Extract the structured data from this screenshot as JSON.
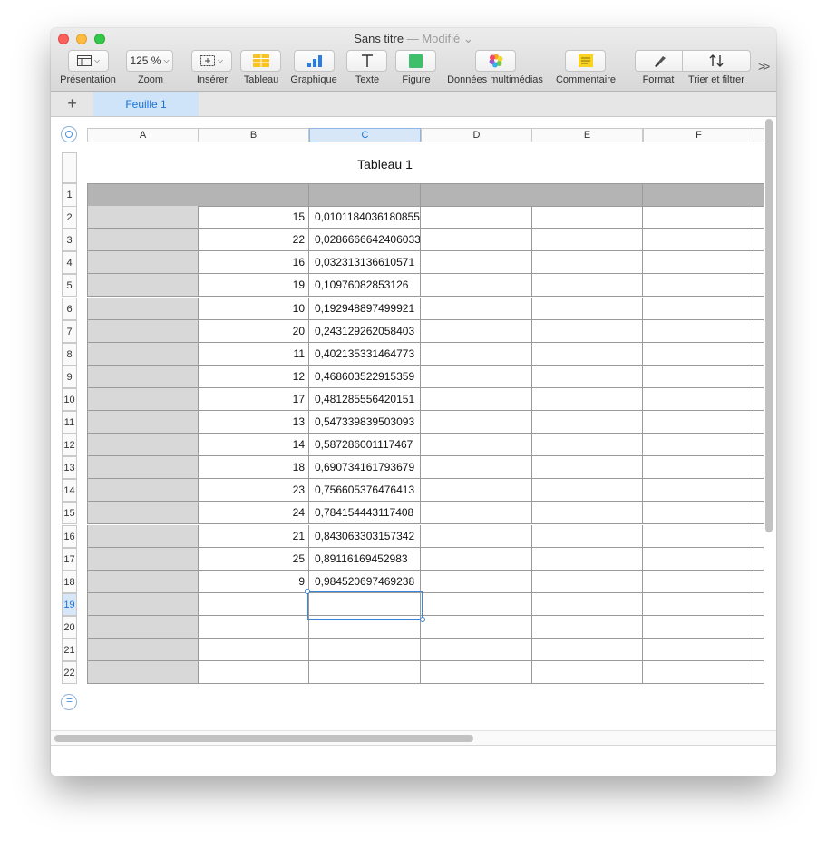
{
  "window": {
    "title": "Sans titre",
    "title_status": "— Modifié",
    "title_chevron": "⌄"
  },
  "toolbar": {
    "items": [
      {
        "name": "presentation",
        "label": "Présentation",
        "icon": "sidebar-layout-icon"
      },
      {
        "name": "zoom",
        "label": "Zoom",
        "value": "125 %"
      },
      {
        "name": "inserer",
        "label": "Insérer",
        "icon": "insert-plus-icon"
      },
      {
        "name": "tableau",
        "label": "Tableau",
        "icon": "table-icon",
        "color": "#f7c325"
      },
      {
        "name": "graphique",
        "label": "Graphique",
        "icon": "bar-chart-icon",
        "color": "#2b7ce9"
      },
      {
        "name": "texte",
        "label": "Texte",
        "icon": "text-T-icon"
      },
      {
        "name": "figure",
        "label": "Figure",
        "icon": "shape-square-icon",
        "color": "#3fbf6a"
      },
      {
        "name": "donnees",
        "label": "Données multimédias",
        "icon": "photos-flower-icon"
      },
      {
        "name": "commentaire",
        "label": "Commentaire",
        "icon": "comment-note-icon",
        "color": "#f8d322"
      },
      {
        "name": "format",
        "label": "Format",
        "icon": "paintbrush-icon"
      },
      {
        "name": "trier",
        "label": "Trier et filtrer",
        "icon": "sort-arrows-icon"
      }
    ],
    "overflow": ">>"
  },
  "sheets": {
    "add": "+",
    "tabs": [
      "Feuille 1"
    ]
  },
  "table": {
    "title": "Tableau 1",
    "columns": [
      "A",
      "B",
      "C",
      "D",
      "E",
      "F"
    ],
    "selected_column": "C",
    "selected_row": "19",
    "rows": [
      {
        "n": "1",
        "b": "",
        "c": ""
      },
      {
        "n": "2",
        "b": "15",
        "c": "0,0101184036180855"
      },
      {
        "n": "3",
        "b": "22",
        "c": "0,0286666642406033"
      },
      {
        "n": "4",
        "b": "16",
        "c": "0,032313136610571"
      },
      {
        "n": "5",
        "b": "19",
        "c": "0,10976082853126"
      },
      {
        "n": "6",
        "b": "10",
        "c": "0,192948897499921"
      },
      {
        "n": "7",
        "b": "20",
        "c": "0,243129262058403"
      },
      {
        "n": "8",
        "b": "11",
        "c": "0,402135331464773"
      },
      {
        "n": "9",
        "b": "12",
        "c": "0,468603522915359"
      },
      {
        "n": "10",
        "b": "17",
        "c": "0,481285556420151"
      },
      {
        "n": "11",
        "b": "13",
        "c": "0,547339839503093"
      },
      {
        "n": "12",
        "b": "14",
        "c": "0,587286001117467"
      },
      {
        "n": "13",
        "b": "18",
        "c": "0,690734161793679"
      },
      {
        "n": "14",
        "b": "23",
        "c": "0,756605376476413"
      },
      {
        "n": "15",
        "b": "24",
        "c": "0,784154443117408"
      },
      {
        "n": "16",
        "b": "21",
        "c": "0,843063303157342"
      },
      {
        "n": "17",
        "b": "25",
        "c": "0,89116169452983"
      },
      {
        "n": "18",
        "b": "9",
        "c": "0,984520697469238"
      },
      {
        "n": "19",
        "b": "",
        "c": ""
      },
      {
        "n": "20",
        "b": "",
        "c": ""
      },
      {
        "n": "21",
        "b": "",
        "c": ""
      },
      {
        "n": "22",
        "b": "",
        "c": ""
      }
    ]
  }
}
